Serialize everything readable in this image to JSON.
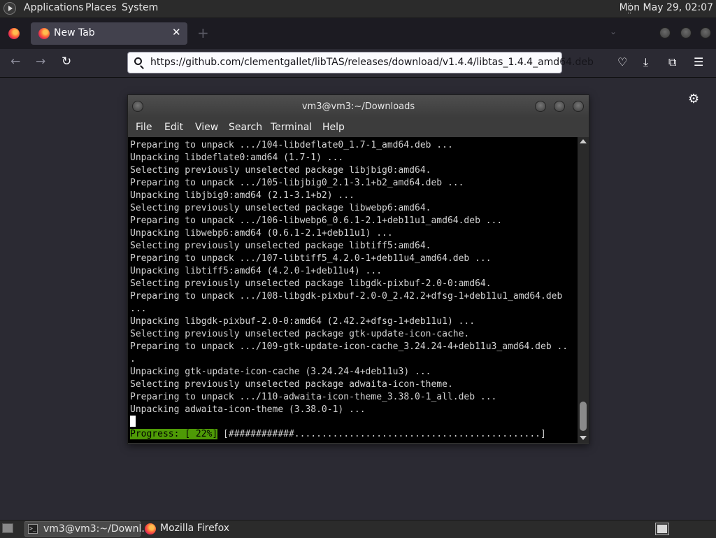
{
  "top_panel": {
    "menus": [
      "Applications",
      "Places",
      "System"
    ],
    "clock": "Mon May 29, 02:07"
  },
  "browser": {
    "tab": {
      "title": "New Tab",
      "close": "✕"
    },
    "new_tab": "+",
    "tab_list": "⌄",
    "url": "https://github.com/clementgallet/libTAS/releases/download/v1.4.4/libtas_1.4.4_amd64.deb",
    "nav": {
      "back": "←",
      "forward": "→",
      "reload": "↻"
    },
    "toolbar_icons": {
      "pocket": "♡",
      "downloads": "⤓",
      "extensions": "⧉",
      "menu": "☰"
    },
    "settings": "⚙"
  },
  "terminal": {
    "title": "vm3@vm3:~/Downloads",
    "menu": [
      "File",
      "Edit",
      "View",
      "Search",
      "Terminal",
      "Help"
    ],
    "lines": [
      "Preparing to unpack .../104-libdeflate0_1.7-1_amd64.deb ...",
      "Unpacking libdeflate0:amd64 (1.7-1) ...",
      "Selecting previously unselected package libjbig0:amd64.",
      "Preparing to unpack .../105-libjbig0_2.1-3.1+b2_amd64.deb ...",
      "Unpacking libjbig0:amd64 (2.1-3.1+b2) ...",
      "Selecting previously unselected package libwebp6:amd64.",
      "Preparing to unpack .../106-libwebp6_0.6.1-2.1+deb11u1_amd64.deb ...",
      "Unpacking libwebp6:amd64 (0.6.1-2.1+deb11u1) ...",
      "Selecting previously unselected package libtiff5:amd64.",
      "Preparing to unpack .../107-libtiff5_4.2.0-1+deb11u4_amd64.deb ...",
      "Unpacking libtiff5:amd64 (4.2.0-1+deb11u4) ...",
      "Selecting previously unselected package libgdk-pixbuf-2.0-0:amd64.",
      "Preparing to unpack .../108-libgdk-pixbuf-2.0-0_2.42.2+dfsg-1+deb11u1_amd64.deb",
      "...",
      "Unpacking libgdk-pixbuf-2.0-0:amd64 (2.42.2+dfsg-1+deb11u1) ...",
      "Selecting previously unselected package gtk-update-icon-cache.",
      "Preparing to unpack .../109-gtk-update-icon-cache_3.24.24-4+deb11u3_amd64.deb ..",
      ".",
      "Unpacking gtk-update-icon-cache (3.24.24-4+deb11u3) ...",
      "Selecting previously unselected package adwaita-icon-theme.",
      "Preparing to unpack .../110-adwaita-icon-theme_3.38.0-1_all.deb ...",
      "Unpacking adwaita-icon-theme (3.38.0-1) ..."
    ],
    "progress_label": "Progress: [ 22%]",
    "progress_bar": " [############.............................................]"
  },
  "taskbar": {
    "tasks": [
      "vm3@vm3:~/Downl...",
      "Mozilla Firefox"
    ]
  },
  "colors": {
    "progress_highlight": "#4e9a06",
    "browser_bg": "#2b2a33"
  }
}
